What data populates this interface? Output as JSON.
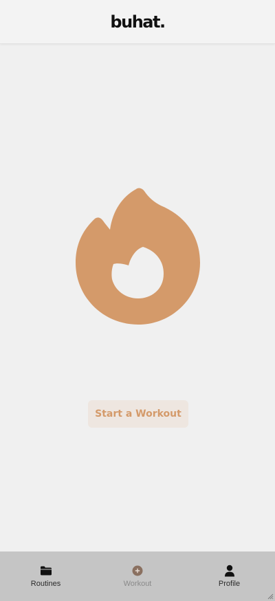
{
  "app": {
    "logo_text": "buhat."
  },
  "main": {
    "hero_icon": "flame-icon",
    "start_button_label": "Start a Workout"
  },
  "nav": {
    "items": [
      {
        "label": "Routines",
        "icon": "folder-icon",
        "active": false
      },
      {
        "label": "Workout",
        "icon": "plus-circle-icon",
        "active": true
      },
      {
        "label": "Profile",
        "icon": "person-icon",
        "active": false
      }
    ]
  },
  "colors": {
    "accent": "#d49a6a",
    "button_bg": "#eee6e0",
    "nav_bg": "#c5c5c5",
    "active_icon": "#8a7060",
    "background": "#f0f0f0"
  }
}
